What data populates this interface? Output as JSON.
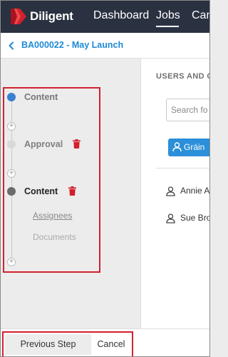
{
  "header": {
    "brand": "Diligent",
    "nav": [
      {
        "label": "Dashboard"
      },
      {
        "label": "Jobs",
        "active": true
      },
      {
        "label": "Cam"
      }
    ],
    "colors": {
      "bar": "#2a3140",
      "logo_red": "#d3202e"
    }
  },
  "breadcrumb": {
    "back_icon": "chevron-left-icon",
    "label": "BA000022 - May Launch"
  },
  "steps": [
    {
      "label": "Content",
      "status": "complete",
      "dot_color": "#3a7fd0",
      "deletable": false
    },
    {
      "label": "Approval",
      "status": "pending",
      "dot_color": "#d9d9d9",
      "deletable": true
    },
    {
      "label": "Content",
      "status": "current",
      "dot_color": "#6b6b6b",
      "deletable": true,
      "sub_items": [
        {
          "label": "Assignees"
        },
        {
          "label": "Documents"
        }
      ]
    }
  ],
  "users_panel": {
    "heading": "USERS AND G",
    "search_placeholder": "Search fo",
    "group_button": "Gráin",
    "users": [
      {
        "name": "Annie A"
      },
      {
        "name": "Sue Bro"
      }
    ]
  },
  "footer": {
    "previous_label": "Previous Step",
    "cancel_label": "Cancel"
  },
  "highlight_color": "#d3202e"
}
